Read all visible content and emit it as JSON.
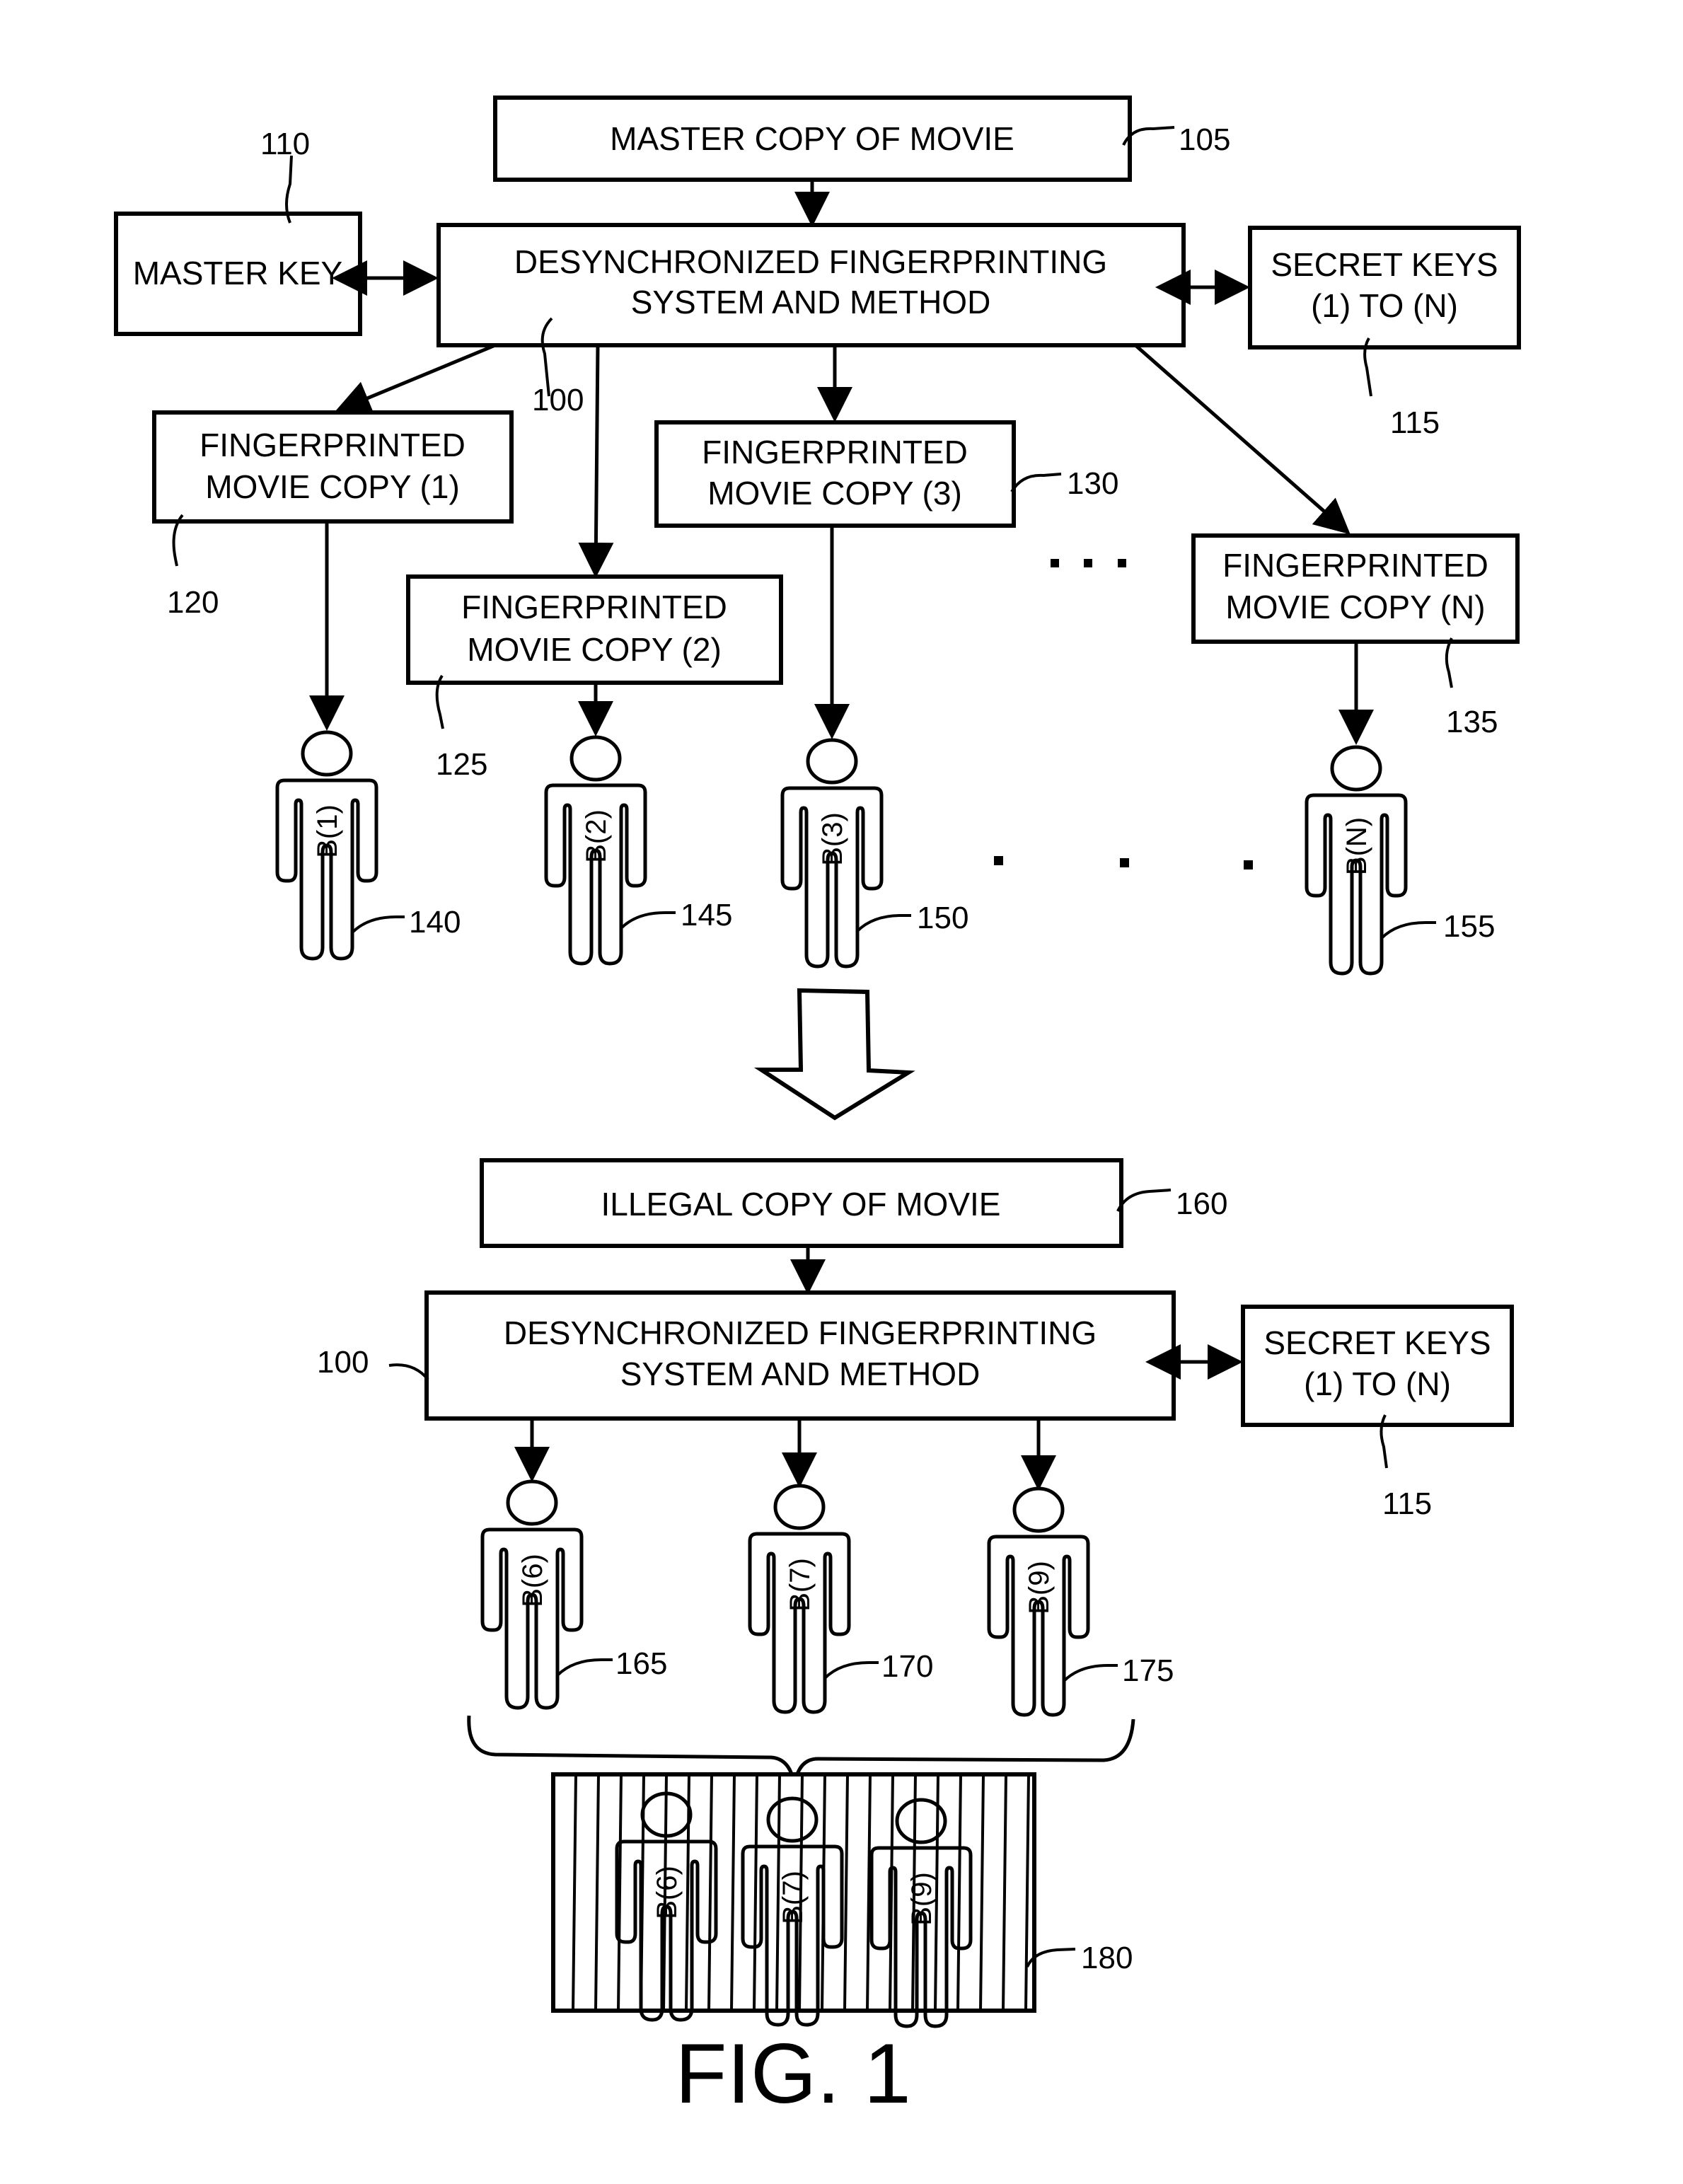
{
  "figure": {
    "caption": "FIG. 1",
    "stage1": {
      "master_copy": {
        "label": "MASTER COPY OF MOVIE",
        "ref": "105"
      },
      "master_key": {
        "label": "MASTER KEY",
        "ref": "110"
      },
      "system": {
        "line1": "DESYNCHRONIZED FINGERPRINTING",
        "line2": "SYSTEM AND METHOD",
        "ref": "100"
      },
      "secret_keys": {
        "line1": "SECRET KEYS",
        "line2": "(1) TO (N)",
        "ref": "115"
      },
      "copies": [
        {
          "line1": "FINGERPRINTED",
          "line2": "MOVIE COPY (1)",
          "ref": "120"
        },
        {
          "line1": "FINGERPRINTED",
          "line2": "MOVIE COPY (2)",
          "ref": "125"
        },
        {
          "line1": "FINGERPRINTED",
          "line2": "MOVIE COPY (3)",
          "ref": "130"
        },
        {
          "line1": "FINGERPRINTED",
          "line2": "MOVIE COPY (N)",
          "ref": "135"
        }
      ],
      "buyers": [
        {
          "label": "B(1)",
          "ref": "140"
        },
        {
          "label": "B(2)",
          "ref": "145"
        },
        {
          "label": "B(3)",
          "ref": "150"
        },
        {
          "label": "B(N)",
          "ref": "155"
        }
      ]
    },
    "stage2": {
      "illegal_copy": {
        "label": "ILLEGAL COPY OF MOVIE",
        "ref": "160"
      },
      "system": {
        "line1": "DESYNCHRONIZED FINGERPRINTING",
        "line2": "SYSTEM AND METHOD",
        "ref": "100"
      },
      "secret_keys": {
        "line1": "SECRET KEYS",
        "line2": "(1) TO (N)",
        "ref": "115"
      },
      "colluders": [
        {
          "label": "B(6)",
          "ref": "165"
        },
        {
          "label": "B(7)",
          "ref": "170"
        },
        {
          "label": "B(9)",
          "ref": "175"
        }
      ],
      "collusion_image": {
        "ref": "180",
        "labels": [
          "B(6)",
          "B(7)",
          "B(9)"
        ]
      }
    }
  }
}
